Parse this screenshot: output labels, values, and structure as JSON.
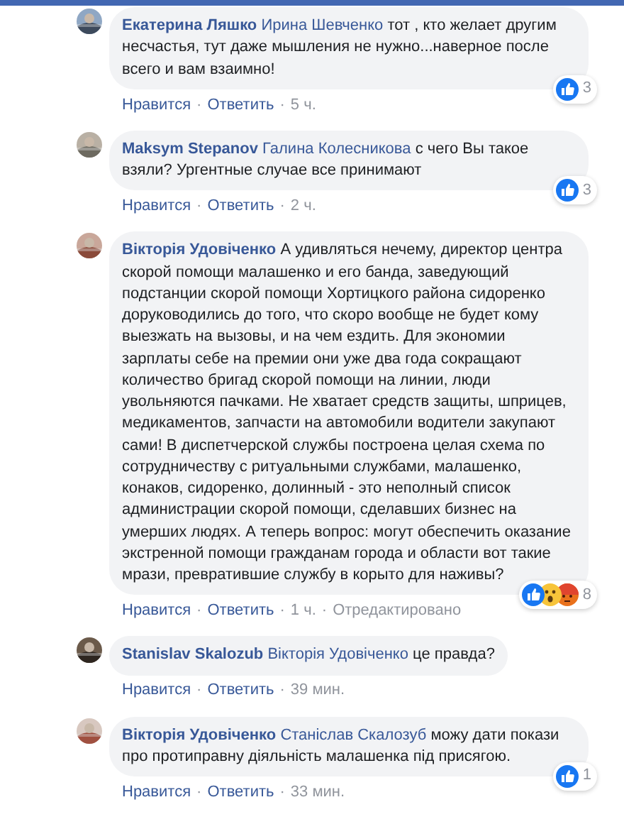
{
  "separator": "·",
  "comments": [
    {
      "author": "Екатерина Ляшко",
      "mention": "Ирина Шевченко",
      "text": "тот , кто желает другим несчастья, тут даже мышления не нужно...наверное после всего и вам взаимно!",
      "reactions": [
        {
          "kind": "like"
        }
      ],
      "reaction_count": "3",
      "actions": [
        {
          "kind": "link",
          "text": "Нравится"
        },
        {
          "kind": "link",
          "text": "Ответить"
        },
        {
          "kind": "time",
          "text": "5 ч."
        }
      ]
    },
    {
      "author": "Maksym Stepanov",
      "mention": "Галина Колесникова",
      "text": "с чего Вы такое взяли? Ургентные случае все принимают",
      "reactions": [
        {
          "kind": "like"
        }
      ],
      "reaction_count": "3",
      "actions": [
        {
          "kind": "link",
          "text": "Нравится"
        },
        {
          "kind": "link",
          "text": "Ответить"
        },
        {
          "kind": "time",
          "text": "2 ч."
        }
      ]
    },
    {
      "author": "Вікторія Удовіченко",
      "text": "А удивляться нечему, директор центра скорой помощи малашенко и его банда, заведующий подстанции скорой помощи Хортицкого района сидоренко доруководились до того, что скоро вообще не будет кому выезжать на вызовы, и на чем ездить. Для экономии зарплаты себе на премии они уже два года сокращают количество бригад скорой помощи на линии, люди увольняются пачками. Не хватает средств защиты, шприцев, медикаментов, запчасти на автомобили водители закупают сами! В диспетчерской службы построена целая схема по сотрудничеству с ритуальными службами, малашенко, конаков, сидоренко, долинный - это неполный список администрации скорой помощи, сделавших бизнес на умерших людях. А теперь вопрос: могут обеспечить оказание экстренной помощи гражданам города и области вот такие мрази, превратившие службу в корыто для наживы?",
      "reactions": [
        {
          "kind": "like"
        },
        {
          "kind": "wow"
        },
        {
          "kind": "angry"
        }
      ],
      "reaction_count": "8",
      "actions": [
        {
          "kind": "link",
          "text": "Нравится"
        },
        {
          "kind": "link",
          "text": "Ответить"
        },
        {
          "kind": "time",
          "text": "1 ч."
        },
        {
          "kind": "time",
          "text": "Отредактировано"
        }
      ]
    },
    {
      "author": "Stanislav Skalozub",
      "mention": "Вікторія Удовіченко",
      "text": "це правда?",
      "actions": [
        {
          "kind": "link",
          "text": "Нравится"
        },
        {
          "kind": "link",
          "text": "Ответить"
        },
        {
          "kind": "time",
          "text": "39 мин."
        }
      ]
    },
    {
      "author": "Вікторія Удовіченко",
      "mention": "Станіслав Скалозуб",
      "text": "можу дати покази про протиправну діяльність малашенка під присягою.",
      "reactions": [
        {
          "kind": "like"
        }
      ],
      "reaction_count": "1",
      "actions": [
        {
          "kind": "link",
          "text": "Нравится"
        },
        {
          "kind": "link",
          "text": "Ответить"
        },
        {
          "kind": "time",
          "text": "33 мин."
        }
      ]
    }
  ]
}
